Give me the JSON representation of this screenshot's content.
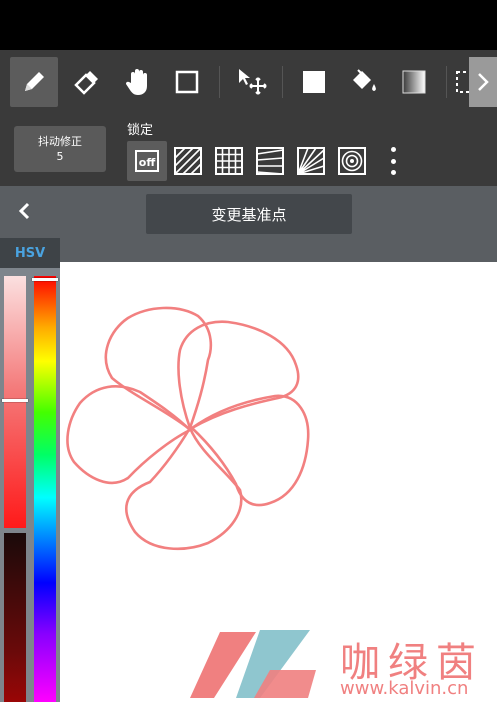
{
  "toolbar": {
    "tools": [
      "pen-icon",
      "eraser-icon",
      "hand-icon",
      "rectangle-icon",
      "move-icon",
      "fill-rect-icon",
      "bucket-icon",
      "gradient-icon",
      "selection-icon"
    ],
    "active_tool": "pen-icon"
  },
  "subbar": {
    "stabilizer_label": "抖动修正",
    "stabilizer_value": "5",
    "lock_label": "锁定",
    "lock_options": [
      "off",
      "parallel-lines",
      "grid",
      "perspective-lines",
      "radial-lines",
      "concentric-circles"
    ],
    "lock_off_text": "off"
  },
  "pivot": {
    "change_pivot_label": "变更基准点"
  },
  "color_panel": {
    "mode_tab": "HSV",
    "hue": 0,
    "saturation": 0.53,
    "value": 1.0,
    "current_color": "#f28080"
  },
  "drawing": {
    "stroke_color": "#f28080"
  },
  "watermark": {
    "site_name": "咖绿茵",
    "url": "www.kalvin.cn",
    "colors": {
      "pink": "#f08080",
      "teal": "#8fc6cf"
    }
  }
}
